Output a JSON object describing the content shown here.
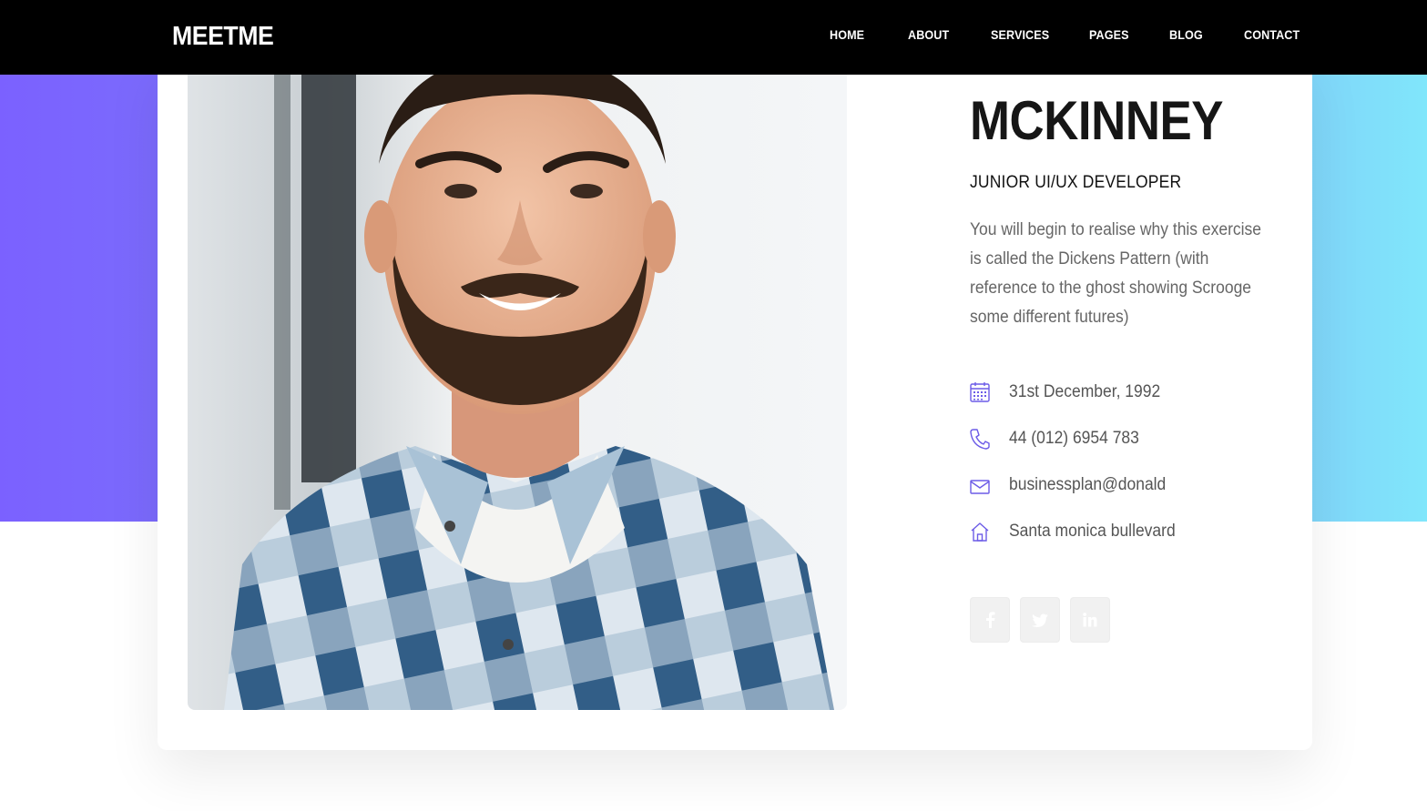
{
  "brand": {
    "logo": "MEETME"
  },
  "nav": {
    "items": [
      {
        "label": "HOME"
      },
      {
        "label": "ABOUT"
      },
      {
        "label": "SERVICES"
      },
      {
        "label": "PAGES"
      },
      {
        "label": "BLOG"
      },
      {
        "label": "CONTACT"
      }
    ]
  },
  "profile": {
    "name": "MCKINNEY",
    "role": "JUNIOR UI/UX DEVELOPER",
    "bio": "You will begin to realise why this exercise is called the Dickens Pattern (with reference to the ghost showing Scrooge some different futures)",
    "info": [
      {
        "icon": "calendar-icon",
        "text": "31st December, 1992"
      },
      {
        "icon": "phone-icon",
        "text": "44 (012) 6954 783"
      },
      {
        "icon": "mail-icon",
        "text": "businessplan@donald"
      },
      {
        "icon": "home-icon",
        "text": "Santa monica bullevard"
      }
    ],
    "socials": [
      {
        "icon": "facebook-icon"
      },
      {
        "icon": "twitter-icon"
      },
      {
        "icon": "linkedin-icon"
      }
    ]
  },
  "colors": {
    "navbar": "#000000",
    "gradient_start": "#7b61ff",
    "gradient_end": "#80e6fb",
    "icon_accent": "#6c5ce7",
    "heading": "#161616",
    "body_text": "#666666"
  }
}
